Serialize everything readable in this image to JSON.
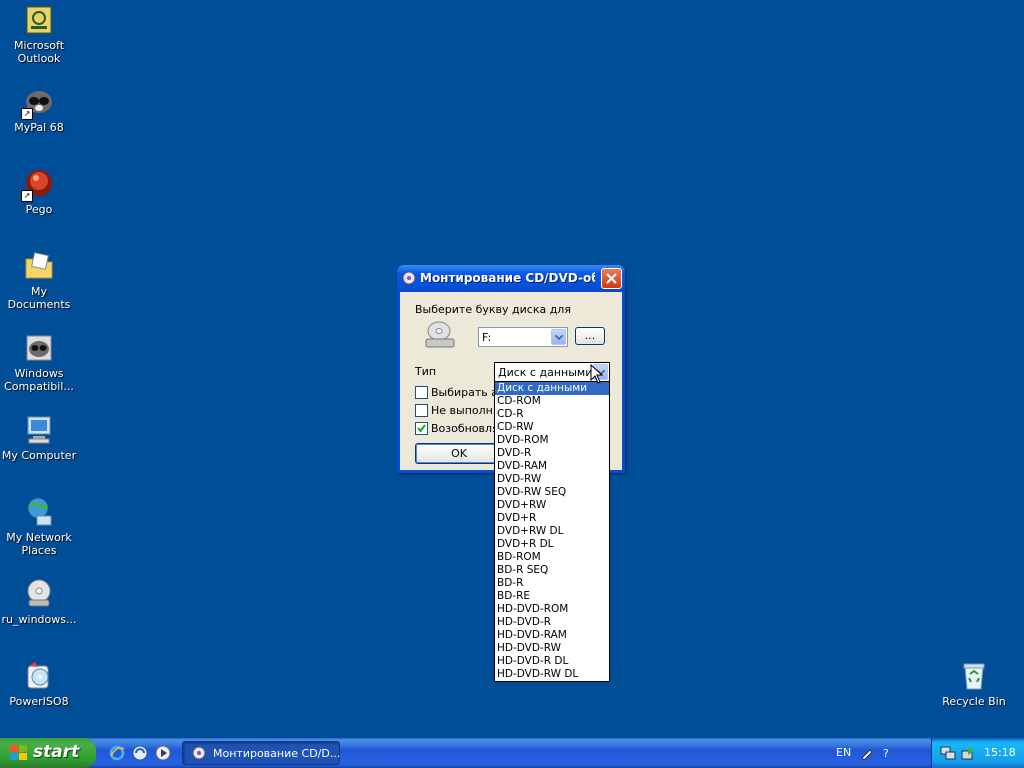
{
  "desktop": {
    "icons": [
      {
        "label": "Microsoft\nOutlook",
        "icon": "outlook-icon"
      },
      {
        "label": "MyPal 68",
        "icon": "mypal-icon"
      },
      {
        "label": "Pego",
        "icon": "pego-icon"
      },
      {
        "label": "My Documents",
        "icon": "folder-icon"
      },
      {
        "label": "Windows\nCompatibil...",
        "icon": "compat-icon"
      },
      {
        "label": "My Computer",
        "icon": "computer-icon"
      },
      {
        "label": "My Network\nPlaces",
        "icon": "network-icon"
      },
      {
        "label": "ru_windows...",
        "icon": "disc-image-icon"
      },
      {
        "label": "PowerISO8",
        "icon": "poweriso-icon"
      }
    ],
    "recycle_bin": {
      "label": "Recycle Bin"
    }
  },
  "dialog": {
    "title": "Монтирование CD/DVD-об...",
    "pick_label": "Выберите букву диска для",
    "drive_value": "F:",
    "browse_label": "...",
    "type_label": "Тип",
    "type_value": "Диск с данными",
    "checkboxes": [
      {
        "label": "Выбирать ав",
        "checked": false
      },
      {
        "label": "Не выполнят",
        "checked": false
      },
      {
        "label": "Возобновлят",
        "checked": true
      }
    ],
    "ok_label": "OK"
  },
  "dropdown": {
    "selected_index": 0,
    "options": [
      "Диск с данными",
      "CD-ROM",
      "CD-R",
      "CD-RW",
      "DVD-ROM",
      "DVD-R",
      "DVD-RAM",
      "DVD-RW",
      "DVD-RW SEQ",
      "DVD+RW",
      "DVD+R",
      "DVD+RW DL",
      "DVD+R DL",
      "BD-ROM",
      "BD-R SEQ",
      "BD-R",
      "BD-RE",
      "HD-DVD-ROM",
      "HD-DVD-R",
      "HD-DVD-RAM",
      "HD-DVD-RW",
      "HD-DVD-R DL",
      "HD-DVD-RW DL"
    ]
  },
  "taskbar": {
    "start_label": "start",
    "task_label": "Монтирование CD/D...",
    "language": "EN",
    "clock": "15:18"
  }
}
